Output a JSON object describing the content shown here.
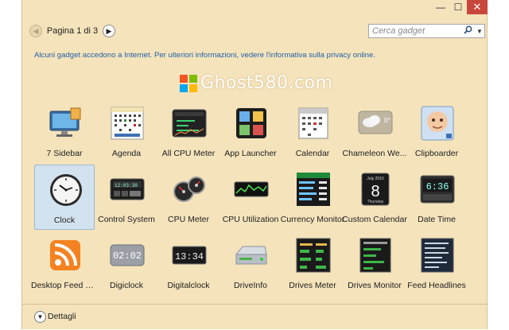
{
  "window": {
    "minimize_glyph": "—",
    "maximize_glyph": "☐",
    "close_glyph": "✕"
  },
  "toolbar": {
    "page_label": "Pagina 1 di 3",
    "search_placeholder": "Cerca gadget"
  },
  "info_text": "Alcuni gadget accedono a Internet. Per ulteriori informazioni, vedere l'informativa sulla privacy online.",
  "watermark": "Ghost580.com",
  "gadgets": [
    {
      "label": "7 Sidebar",
      "icon": "monitor-icon"
    },
    {
      "label": "Agenda",
      "icon": "agenda-icon"
    },
    {
      "label": "All CPU Meter",
      "icon": "cpu-meter-icon"
    },
    {
      "label": "App Launcher",
      "icon": "app-launcher-icon"
    },
    {
      "label": "Calendar",
      "icon": "calendar-icon"
    },
    {
      "label": "Chameleon We...",
      "icon": "weather-icon"
    },
    {
      "label": "Clipboarder",
      "icon": "clipboarder-icon"
    },
    {
      "label": "Clock",
      "icon": "clock-icon",
      "selected": true
    },
    {
      "label": "Control System",
      "icon": "control-system-icon"
    },
    {
      "label": "CPU Meter",
      "icon": "cpu-gauge-icon"
    },
    {
      "label": "CPU Utilization",
      "icon": "cpu-utilization-icon"
    },
    {
      "label": "Currency Monitor",
      "icon": "currency-monitor-icon"
    },
    {
      "label": "Custom Calendar",
      "icon": "custom-calendar-icon"
    },
    {
      "label": "Date Time",
      "icon": "date-time-icon"
    },
    {
      "label": "Desktop Feed R...",
      "icon": "rss-feed-icon"
    },
    {
      "label": "Digiclock",
      "icon": "digiclock-icon"
    },
    {
      "label": "Digitalclock",
      "icon": "digitalclock-icon"
    },
    {
      "label": "DriveInfo",
      "icon": "drive-icon"
    },
    {
      "label": "Drives Meter",
      "icon": "drives-meter-icon"
    },
    {
      "label": "Drives Monitor",
      "icon": "drives-monitor-icon"
    },
    {
      "label": "Feed Headlines",
      "icon": "feed-headlines-icon"
    }
  ],
  "footer": {
    "details_label": "Dettagli"
  }
}
